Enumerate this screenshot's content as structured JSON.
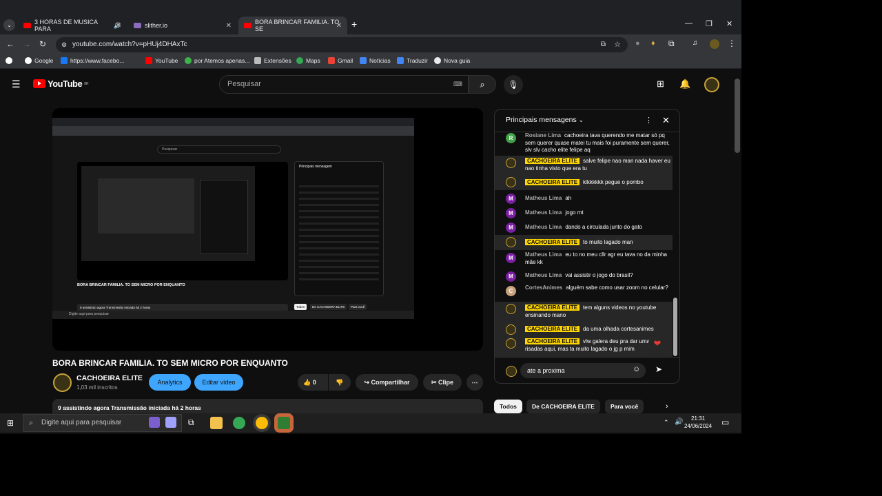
{
  "browser": {
    "tabs": [
      {
        "title": "3 HORAS DE MUSICA PARA",
        "icon": "youtube-icon",
        "audio": true
      },
      {
        "title": "slither.io",
        "icon": "slither-icon"
      },
      {
        "title": "BORA BRINCAR FAMILIA. TO SE",
        "icon": "youtube-icon",
        "active": true
      }
    ],
    "url": "youtube.com/watch?v=pHUj4DHAxTc",
    "bookmarks": [
      "Google",
      "https://www.facebo...",
      "YouTube",
      "por Atemos apenas...",
      "Extensões",
      "Maps",
      "Gmail",
      "Notícias",
      "Traduzir",
      "Nova guia"
    ]
  },
  "youtube": {
    "logo": "YouTube",
    "region": "BR",
    "search_placeholder": "Pesquisar"
  },
  "video": {
    "title": "BORA BRINCAR FAMILIA. TO SEM MICRO POR ENQUANTO",
    "channel": "CACHOEIRA ELITE",
    "subscribers": "1,03 mil inscritos",
    "analytics_label": "Analytics",
    "edit_label": "Editar vídeo",
    "likes": "0",
    "share_label": "Compartilhar",
    "clip_label": "Clipe",
    "description": "9 assistindo agora  Transmissão iniciada há 2 horas"
  },
  "chat": {
    "header": "Principais mensagens",
    "messages": [
      {
        "author": "Rosiane Lima",
        "avatar_letter": "R",
        "avatar_color": "#43a047",
        "text": "cachoeira tava querendo me matar só pq sem querer quase matei tu mais foi puramente sem querer, slv slv cacho elite felipe aq"
      },
      {
        "author": "CACHOEIRA ELITE",
        "owner": true,
        "text": "salve felipe nao man nada haver eu nao tinha visto que era tu"
      },
      {
        "author": "CACHOEIRA ELITE",
        "owner": true,
        "text": "klkkkkkk pegue o pombo"
      },
      {
        "author": "Matheus Lima",
        "avatar_letter": "M",
        "avatar_color": "#7b1fa2",
        "text": "ah"
      },
      {
        "author": "Matheus Lima",
        "avatar_letter": "M",
        "avatar_color": "#7b1fa2",
        "text": "jogo mt"
      },
      {
        "author": "Matheus Lima",
        "avatar_letter": "M",
        "avatar_color": "#7b1fa2",
        "text": "dando a circulada junto do gato"
      },
      {
        "author": "CACHOEIRA ELITE",
        "owner": true,
        "text": "to muito lagado man"
      },
      {
        "author": "Matheus Lima",
        "avatar_letter": "M",
        "avatar_color": "#7b1fa2",
        "text": "eu to no meu cllr agr eu tava no da minha mãe kk"
      },
      {
        "author": "Matheus Lima",
        "avatar_letter": "M",
        "avatar_color": "#7b1fa2",
        "text": "vai assistir o jogo do brasil?"
      },
      {
        "author": "CortesAnimes",
        "avatar_letter": "C",
        "avatar_color": "#c8a27a",
        "text": "alguém sabe como usar zoom no celular?"
      },
      {
        "author": "CACHOEIRA ELITE",
        "owner": true,
        "text": "tem alguns videos no youtube ensinando mano"
      },
      {
        "author": "CACHOEIRA ELITE",
        "owner": true,
        "text": "da uma olhada cortesanimes"
      },
      {
        "author": "CACHOEIRA ELITE",
        "owner": true,
        "text": "vlw galera deu pra dar umas risadas aqui, mas ta muito lagado o jg p mim"
      }
    ],
    "input_value": "ate a proxima",
    "chips": [
      "Todos",
      "De CACHOEIRA ELITE",
      "Para você"
    ]
  },
  "taskbar": {
    "search_placeholder": "Digite aqui para pesquisar",
    "time": "21:31",
    "date": "24/06/2024"
  },
  "embedded": {
    "title": "BORA BRINCAR FAMILIA. TO SEM MICRO POR ENQUANTO",
    "chat_header": "Principais mensagem",
    "search": "Pesquisar",
    "taskbar_search": "Digite aqui para pesquisar",
    "chips": [
      "Todos",
      "De CACHOEIRA ELITE",
      "Para você"
    ],
    "description": "9 assistindo agora  Transmissão iniciada há 2 horas"
  }
}
